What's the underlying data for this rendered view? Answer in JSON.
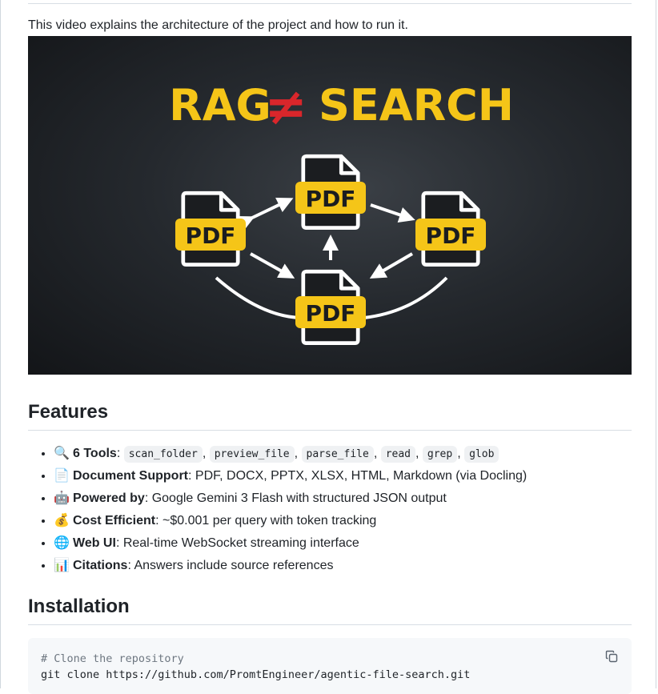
{
  "intro_text": "This video explains the architecture of the project and how to run it.",
  "video": {
    "headline_left": "RAG",
    "headline_symbol": "≠",
    "headline_right": "SEARCH",
    "file_label": "PDF",
    "colors": {
      "yellow": "#f5c518",
      "red": "#d9262b",
      "white": "#ffffff"
    }
  },
  "features": {
    "heading": "Features",
    "items": [
      {
        "emoji": "🔍",
        "title": "6 Tools",
        "sep": ":",
        "codes": [
          "scan_folder",
          "preview_file",
          "parse_file",
          "read",
          "grep",
          "glob"
        ]
      },
      {
        "emoji": "📄",
        "title": "Document Support",
        "text": ": PDF, DOCX, PPTX, XLSX, HTML, Markdown (via Docling)"
      },
      {
        "emoji": "🤖",
        "title": "Powered by",
        "text": ": Google Gemini 3 Flash with structured JSON output"
      },
      {
        "emoji": "💰",
        "title": "Cost Efficient",
        "text": ": ~$0.001 per query with token tracking"
      },
      {
        "emoji": "🌐",
        "title": "Web UI",
        "text": ": Real-time WebSocket streaming interface"
      },
      {
        "emoji": "📊",
        "title": "Citations",
        "text": ": Answers include source references"
      }
    ]
  },
  "installation": {
    "heading": "Installation",
    "code_comment": "# Clone the repository",
    "code_line": "git clone https://github.com/PromtEngineer/agentic-file-search.git",
    "copy_icon": "copy-icon"
  }
}
